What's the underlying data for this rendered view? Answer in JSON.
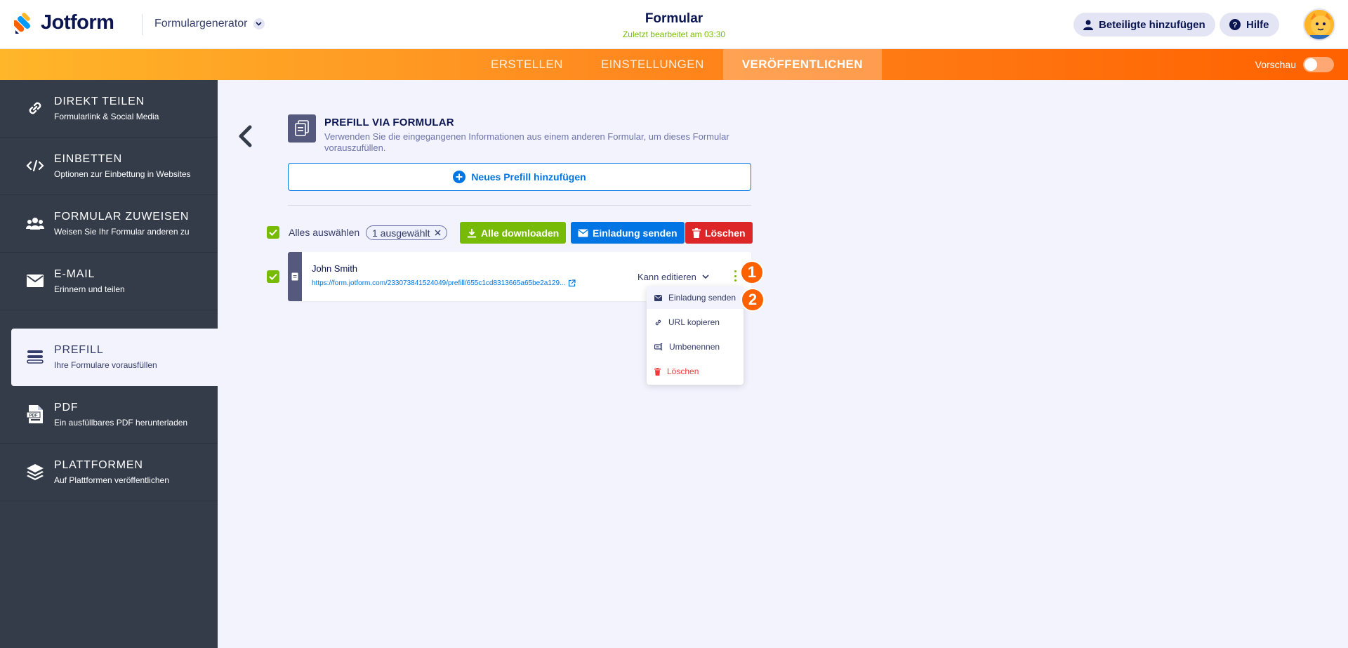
{
  "header": {
    "logo_text": "Jotform",
    "app_switcher": "Formulargenerator",
    "form_title": "Formular",
    "last_edited": "Zuletzt bearbeitet am 03:30",
    "add_participants": "Beteiligte hinzufügen",
    "help": "Hilfe"
  },
  "nav": {
    "tabs": [
      {
        "label": "ERSTELLEN"
      },
      {
        "label": "EINSTELLUNGEN"
      },
      {
        "label": "VERÖFFENTLICHEN"
      }
    ],
    "preview_label": "Vorschau"
  },
  "sidebar": {
    "items": [
      {
        "title": "DIREKT TEILEN",
        "sub": "Formularlink & Social Media",
        "icon": "link-icon"
      },
      {
        "title": "EINBETTEN",
        "sub": "Optionen zur Einbettung in Websites",
        "icon": "code-icon"
      },
      {
        "title": "FORMULAR ZUWEISEN",
        "sub": "Weisen Sie Ihr Formular anderen zu",
        "icon": "users-icon"
      },
      {
        "title": "E-MAIL",
        "sub": "Erinnern und teilen",
        "icon": "mail-icon"
      },
      {
        "title": "PREFILL",
        "sub": "Ihre Formulare vorausfüllen",
        "icon": "prefill-icon"
      },
      {
        "title": "PDF",
        "sub": "Ein ausfüllbares PDF herunterladen",
        "icon": "pdf-icon"
      },
      {
        "title": "PLATTFORMEN",
        "sub": "Auf Plattformen veröffentlichen",
        "icon": "layers-icon"
      }
    ]
  },
  "main": {
    "section_title": "PREFILL VIA FORMULAR",
    "section_desc": "Verwenden Sie die eingegangenen Informationen aus einem anderen Formular, um dieses Formular vorauszufüllen.",
    "add_prefill": "Neues Prefill hinzufügen",
    "select_all": "Alles auswählen",
    "selected_chip": "1 ausgewählt",
    "download_all": "Alle downloaden",
    "send_invite": "Einladung senden",
    "delete": "Löschen",
    "row": {
      "name": "John Smith",
      "url": "https://form.jotform.com/233073841524049/prefill/655c1cd8313665a65be2a129...",
      "permission": "Kann editieren"
    },
    "menu": {
      "items": [
        {
          "label": "Einladung senden"
        },
        {
          "label": "URL kopieren"
        },
        {
          "label": "Umbenennen"
        },
        {
          "label": "Löschen"
        }
      ]
    },
    "badges": [
      "1",
      "2"
    ]
  },
  "colors": {
    "accent_orange": "#ff6100",
    "green": "#78bb07",
    "blue": "#0075e3",
    "red": "#dc2628",
    "sidebar_bg": "#343c4a"
  }
}
